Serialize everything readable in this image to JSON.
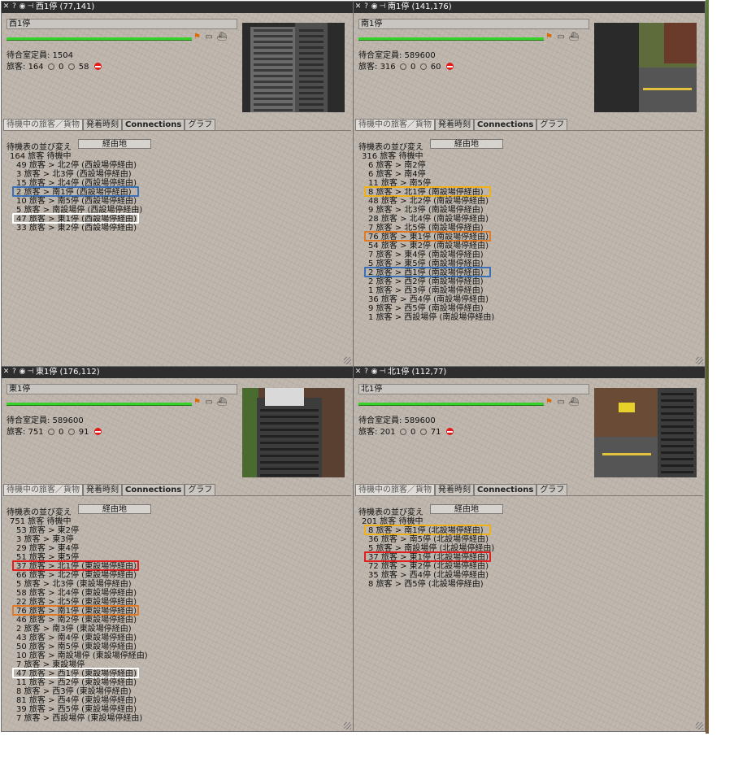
{
  "windows": [
    {
      "title": "西1停 (77,141)",
      "name": "西1停",
      "capacity_line": "待合室定員: 1504",
      "passengers_label": "旅客:",
      "passengers": "164",
      "zero": "0",
      "unhappy": "58",
      "tabs": [
        "待機中の旅客／貨物",
        "発着時刻",
        "Connections",
        "グラフ"
      ],
      "sort_label": "待機表の並び変え",
      "sort_button": "経由地",
      "header": "164 旅客 待機中",
      "rows": [
        {
          "text": "49 旅客 > 北2停 (西設場停経由)",
          "hl": ""
        },
        {
          "text": "3 旅客 > 北3停 (西設場停経由)",
          "hl": ""
        },
        {
          "text": "15 旅客 > 北4停 (西設場停経由)",
          "hl": ""
        },
        {
          "text": "2 旅客 > 南1停 (西設場停経由)",
          "hl": "blue"
        },
        {
          "text": "10 旅客 > 南5停 (西設場停経由)",
          "hl": ""
        },
        {
          "text": "5 旅客 > 南設場停 (西設場停経由)",
          "hl": ""
        },
        {
          "text": "47 旅客 > 東1停 (西設場停経由)",
          "hl": "white"
        },
        {
          "text": "33 旅客 > 東2停 (西設場停経由)",
          "hl": ""
        }
      ]
    },
    {
      "title": "南1停 (141,176)",
      "name": "南1停",
      "capacity_line": "待合室定員: 589600",
      "passengers_label": "旅客:",
      "passengers": "316",
      "zero": "0",
      "unhappy": "60",
      "tabs": [
        "待機中の旅客／貨物",
        "発着時刻",
        "Connections",
        "グラフ"
      ],
      "sort_label": "待機表の並び変え",
      "sort_button": "経由地",
      "header": "316 旅客 待機中",
      "rows": [
        {
          "text": "6 旅客 > 南2停",
          "hl": ""
        },
        {
          "text": "6 旅客 > 南4停",
          "hl": ""
        },
        {
          "text": "11 旅客 > 南5停",
          "hl": ""
        },
        {
          "text": "8 旅客 > 北1停 (南設場停経由)",
          "hl": "yellow"
        },
        {
          "text": "48 旅客 > 北2停 (南設場停経由)",
          "hl": ""
        },
        {
          "text": "9 旅客 > 北3停 (南設場停経由)",
          "hl": ""
        },
        {
          "text": "28 旅客 > 北4停 (南設場停経由)",
          "hl": ""
        },
        {
          "text": "7 旅客 > 北5停 (南設場停経由)",
          "hl": ""
        },
        {
          "text": "76 旅客 > 東1停 (南設場停経由)",
          "hl": "orange"
        },
        {
          "text": "54 旅客 > 東2停 (南設場停経由)",
          "hl": ""
        },
        {
          "text": "7 旅客 > 東4停 (南設場停経由)",
          "hl": ""
        },
        {
          "text": "5 旅客 > 東5停 (南設場停経由)",
          "hl": ""
        },
        {
          "text": "2 旅客 > 西1停 (南設場停経由)",
          "hl": "blue"
        },
        {
          "text": "2 旅客 > 西2停 (南設場停経由)",
          "hl": ""
        },
        {
          "text": "1 旅客 > 西3停 (南設場停経由)",
          "hl": ""
        },
        {
          "text": "36 旅客 > 西4停 (南設場停経由)",
          "hl": ""
        },
        {
          "text": "9 旅客 > 西5停 (南設場停経由)",
          "hl": ""
        },
        {
          "text": "1 旅客 > 西設場停 (南設場停経由)",
          "hl": ""
        }
      ]
    },
    {
      "title": "東1停 (176,112)",
      "name": "東1停",
      "capacity_line": "待合室定員: 589600",
      "passengers_label": "旅客:",
      "passengers": "751",
      "zero": "0",
      "unhappy": "91",
      "tabs": [
        "待機中の旅客／貨物",
        "発着時刻",
        "Connections",
        "グラフ"
      ],
      "sort_label": "待機表の並び変え",
      "sort_button": "経由地",
      "header": "751 旅客 待機中",
      "rows": [
        {
          "text": "53 旅客 > 東2停",
          "hl": ""
        },
        {
          "text": "3 旅客 > 東3停",
          "hl": ""
        },
        {
          "text": "29 旅客 > 東4停",
          "hl": ""
        },
        {
          "text": "51 旅客 > 東5停",
          "hl": ""
        },
        {
          "text": "37 旅客 > 北1停 (東設場停経由)",
          "hl": "red"
        },
        {
          "text": "66 旅客 > 北2停 (東設場停経由)",
          "hl": ""
        },
        {
          "text": "5 旅客 > 北3停 (東設場停経由)",
          "hl": ""
        },
        {
          "text": "58 旅客 > 北4停 (東設場停経由)",
          "hl": ""
        },
        {
          "text": "22 旅客 > 北5停 (東設場停経由)",
          "hl": ""
        },
        {
          "text": "76 旅客 > 南1停 (東設場停経由)",
          "hl": "orange"
        },
        {
          "text": "46 旅客 > 南2停 (東設場停経由)",
          "hl": ""
        },
        {
          "text": "2 旅客 > 南3停 (東設場停経由)",
          "hl": ""
        },
        {
          "text": "43 旅客 > 南4停 (東設場停経由)",
          "hl": ""
        },
        {
          "text": "50 旅客 > 南5停 (東設場停経由)",
          "hl": ""
        },
        {
          "text": "10 旅客 > 南設場停 (東設場停経由)",
          "hl": ""
        },
        {
          "text": "7 旅客 > 東設場停",
          "hl": ""
        },
        {
          "text": "47 旅客 > 西1停 (東設場停経由)",
          "hl": "white"
        },
        {
          "text": "11 旅客 > 西2停 (東設場停経由)",
          "hl": ""
        },
        {
          "text": "8 旅客 > 西3停 (東設場停経由)",
          "hl": ""
        },
        {
          "text": "81 旅客 > 西4停 (東設場停経由)",
          "hl": ""
        },
        {
          "text": "39 旅客 > 西5停 (東設場停経由)",
          "hl": ""
        },
        {
          "text": "7 旅客 > 西設場停 (東設場停経由)",
          "hl": ""
        }
      ]
    },
    {
      "title": "北1停 (112,77)",
      "name": "北1停",
      "capacity_line": "待合室定員: 589600",
      "passengers_label": "旅客:",
      "passengers": "201",
      "zero": "0",
      "unhappy": "71",
      "tabs": [
        "待機中の旅客／貨物",
        "発着時刻",
        "Connections",
        "グラフ"
      ],
      "sort_label": "待機表の並び変え",
      "sort_button": "経由地",
      "header": "201 旅客 待機中",
      "rows": [
        {
          "text": "8 旅客 > 南1停 (北設場停経由)",
          "hl": "yellow"
        },
        {
          "text": "36 旅客 > 南5停 (北設場停経由)",
          "hl": ""
        },
        {
          "text": "5 旅客 > 南設場停 (北設場停経由)",
          "hl": ""
        },
        {
          "text": "37 旅客 > 東1停 (北設場停経由)",
          "hl": "red"
        },
        {
          "text": "72 旅客 > 東2停 (北設場停経由)",
          "hl": ""
        },
        {
          "text": "35 旅客 > 西4停 (北設場停経由)",
          "hl": ""
        },
        {
          "text": "8 旅客 > 西5停 (北設場停経由)",
          "hl": ""
        }
      ]
    }
  ],
  "colors": {
    "titlebar": "#2e2e2e",
    "green_bar": "#36d22a",
    "highlight_blue": "#3b6fb6",
    "highlight_orange": "#e07a26",
    "highlight_yellow": "#efb11a",
    "highlight_red": "#e11f1f",
    "highlight_white": "#ffffff"
  }
}
